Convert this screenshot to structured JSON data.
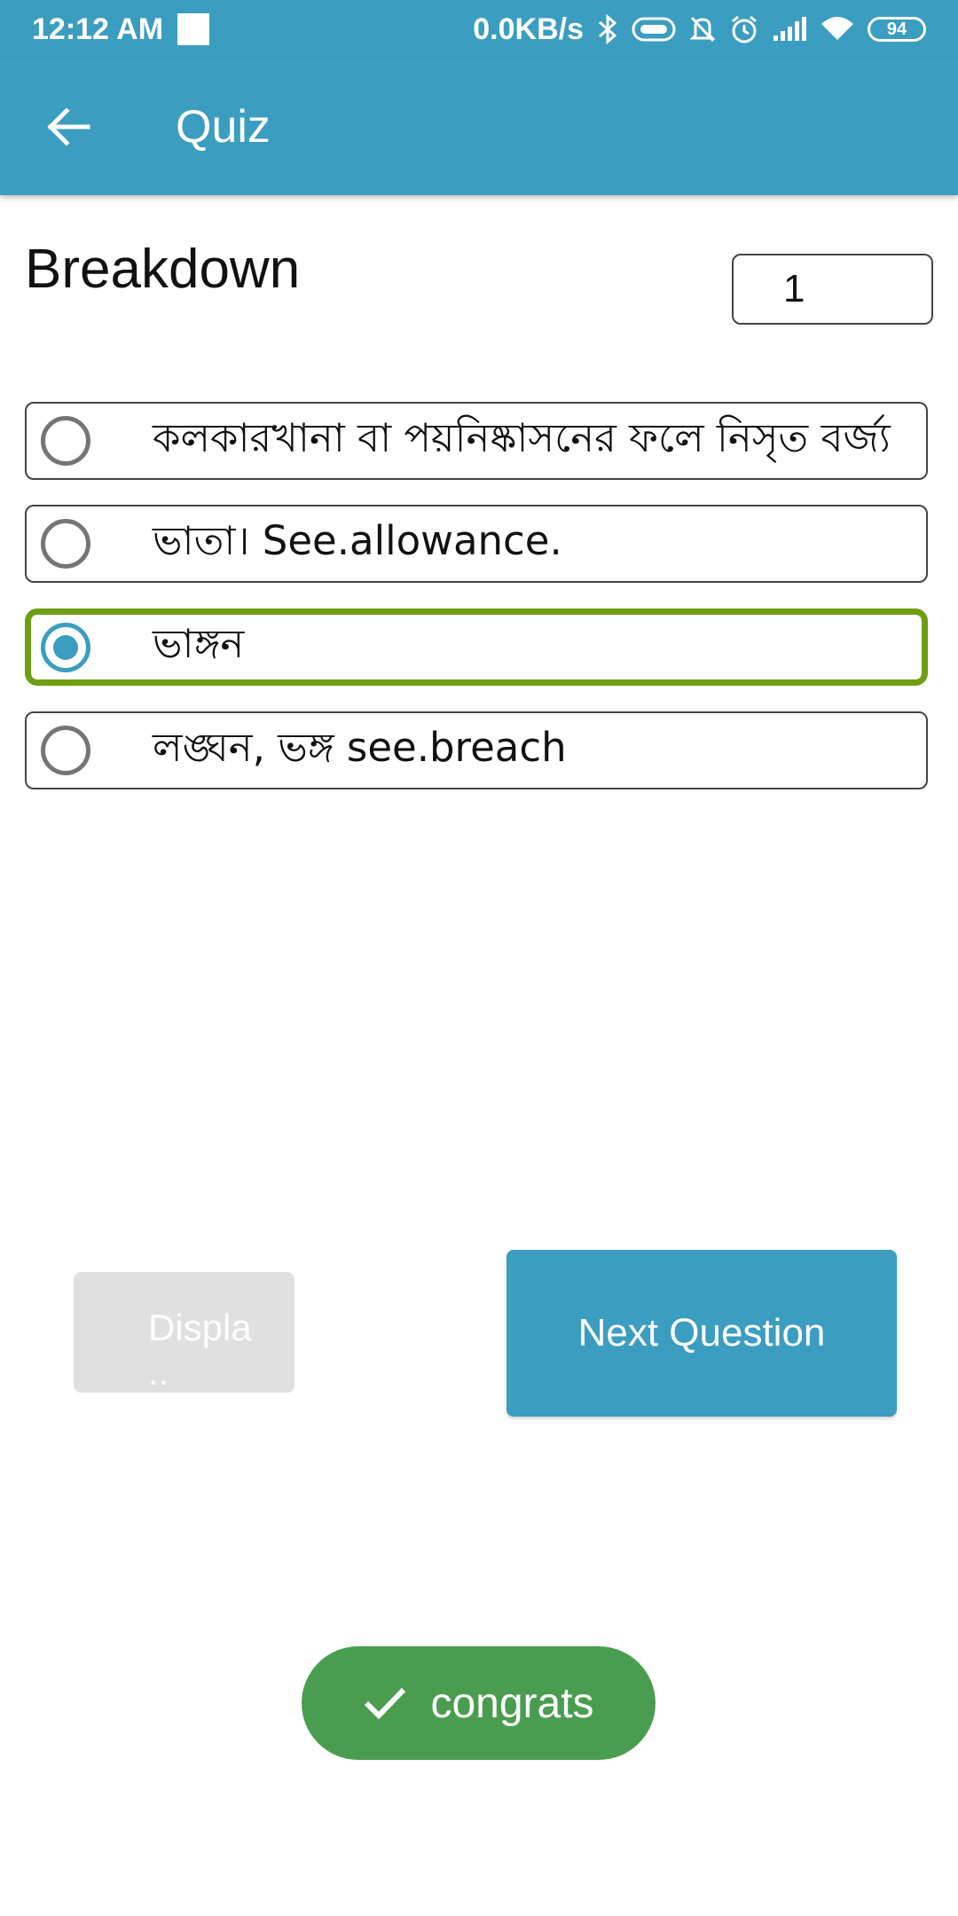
{
  "status_bar": {
    "time": "12:12 AM",
    "network_speed": "0.0KB/s",
    "battery": "94",
    "icons": [
      "bluetooth-icon",
      "vpn-icon",
      "mute-icon",
      "alarm-icon",
      "signal-icon",
      "wifi-icon",
      "battery-icon"
    ]
  },
  "app_bar": {
    "title": "Quiz",
    "back_icon": "arrow-back-icon"
  },
  "quiz": {
    "word": "Breakdown",
    "question_number": "1",
    "options": [
      {
        "label": "কলকারখানা বা পয়নিষ্কাসনের ফলে নিসৃত বর্জ্য",
        "selected": false
      },
      {
        "label": "ভাতা। See.allowance.",
        "selected": false
      },
      {
        "label": "ভাঙ্গন",
        "selected": true
      },
      {
        "label": "লঙ্ঘন, ভঙ্গ see.breach",
        "selected": false
      }
    ],
    "display_button_label": "Displa\n..",
    "next_button_label": "Next Question"
  },
  "toast": {
    "message": "congrats",
    "icon": "check-icon"
  },
  "colors": {
    "primary": "#3b9dbf",
    "selected_border": "#6e9e12",
    "toast_bg": "#4a9d4e",
    "disabled_bg": "#e0e0e0"
  }
}
